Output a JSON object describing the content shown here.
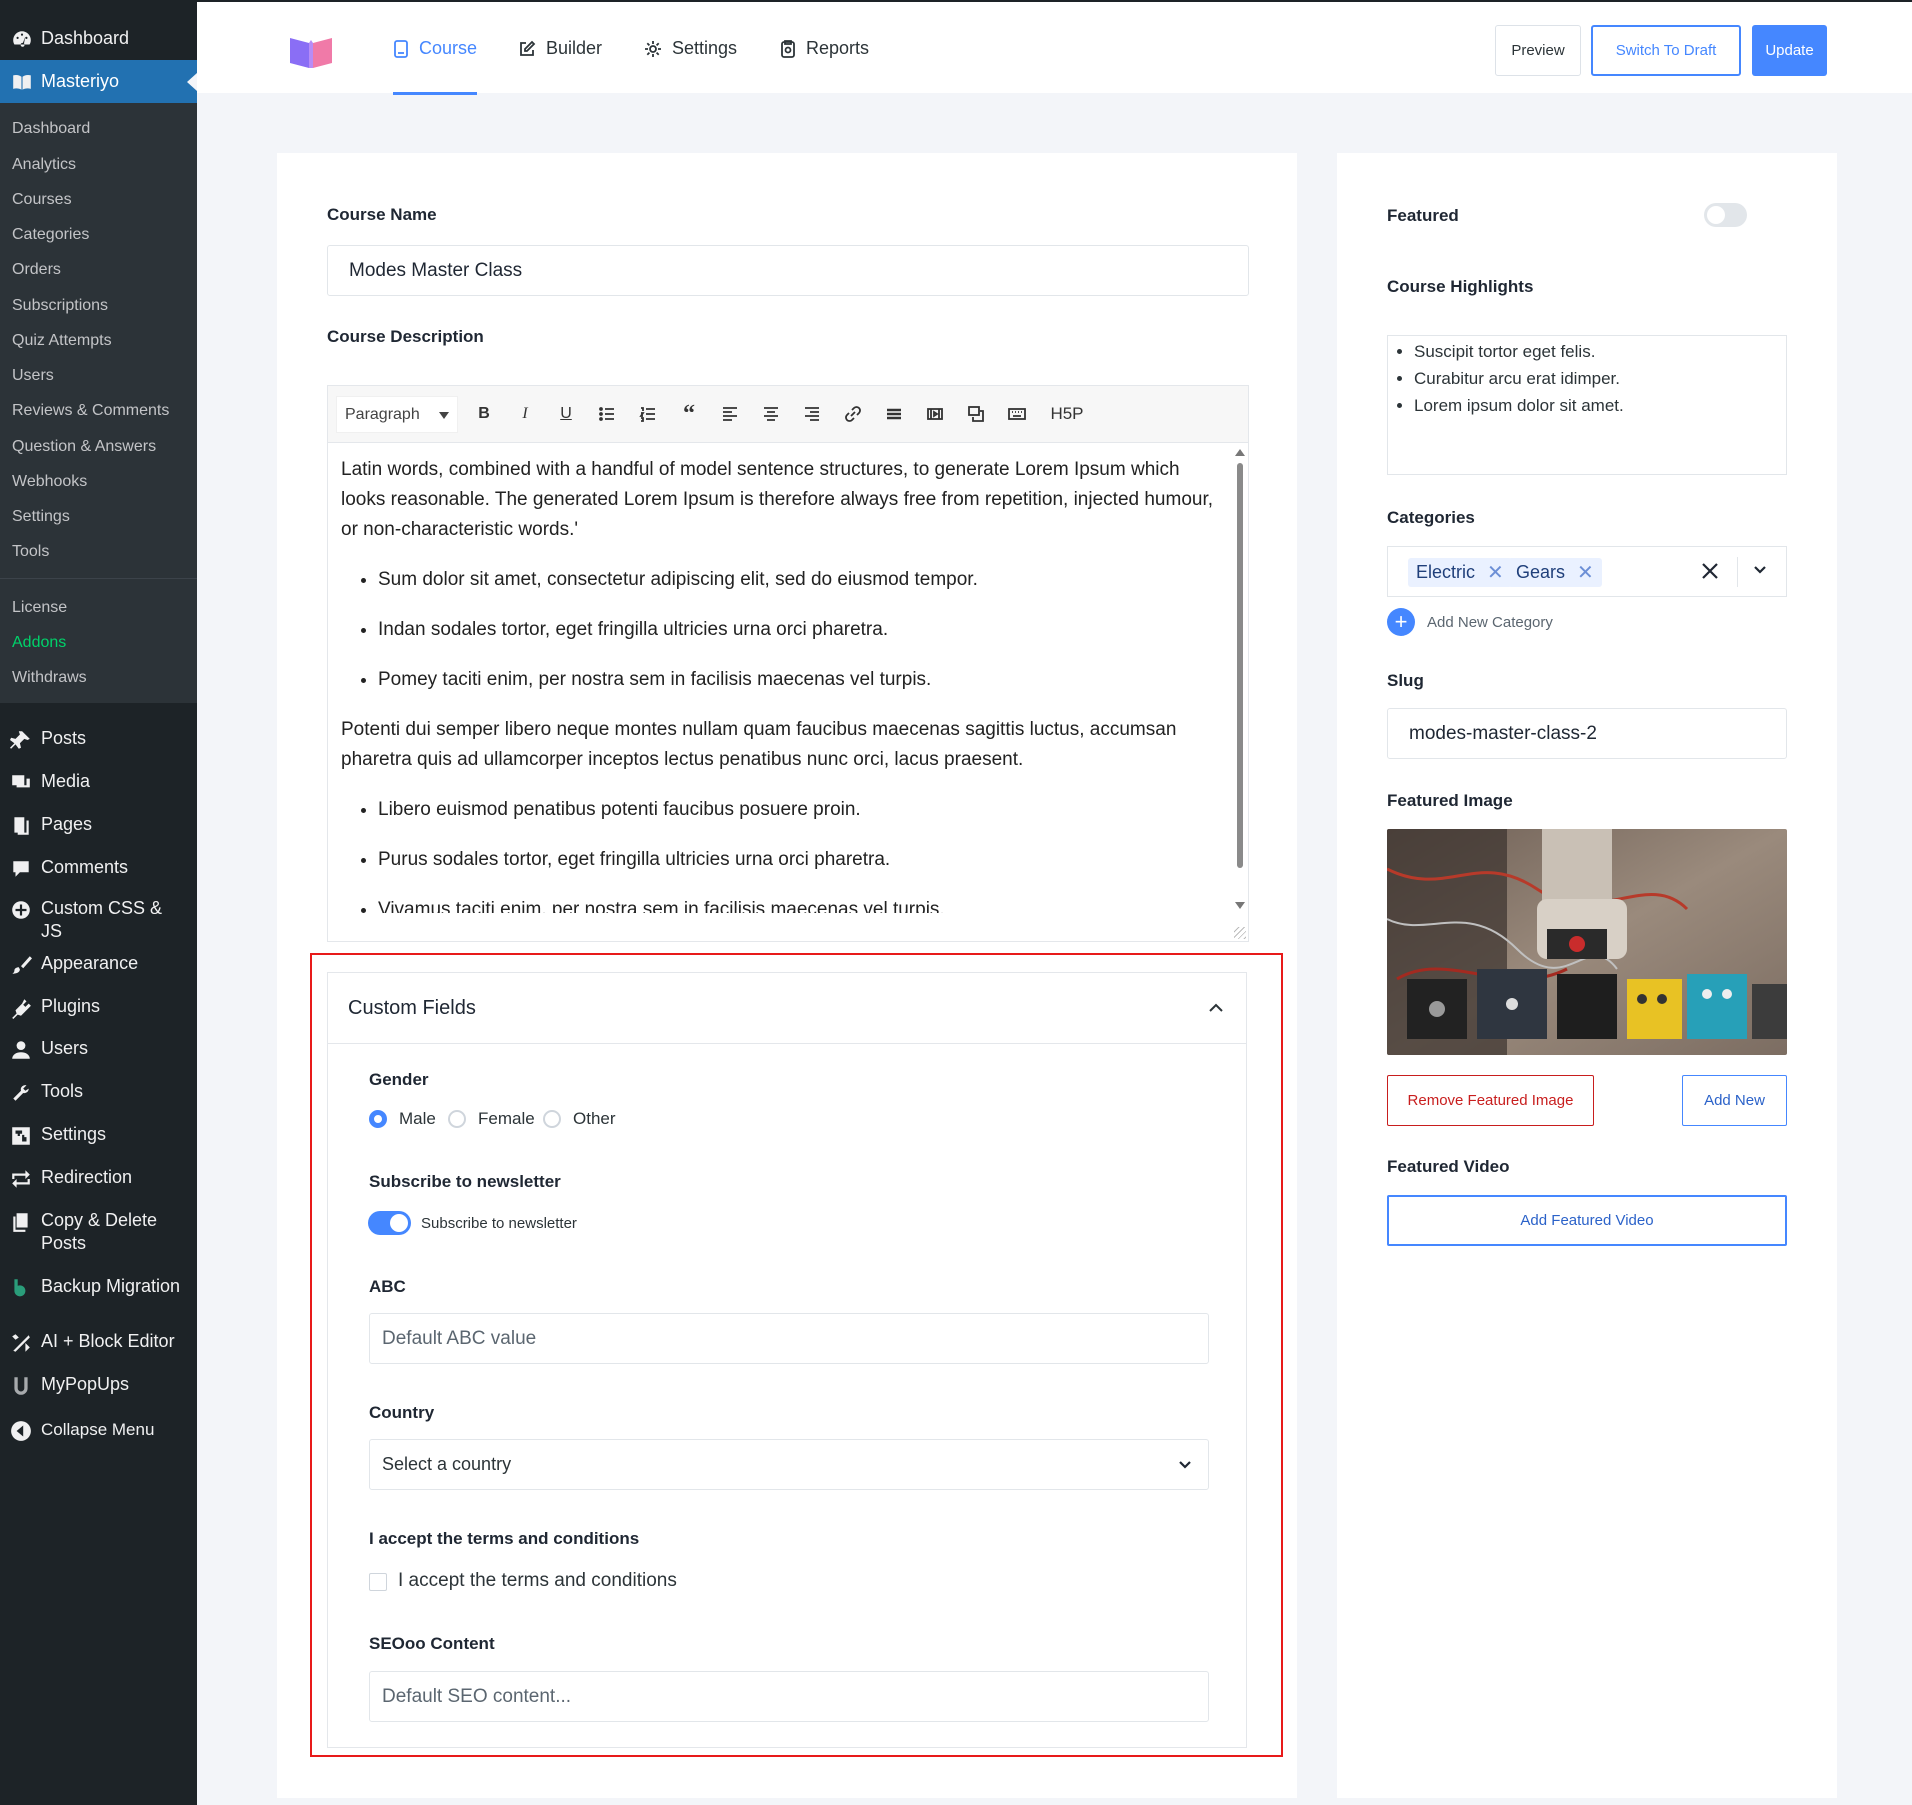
{
  "wp_menu": {
    "dashboard": "Dashboard",
    "masteriyo": "Masteriyo",
    "submenu": [
      "Dashboard",
      "Analytics",
      "Courses",
      "Categories",
      "Orders",
      "Subscriptions",
      "Quiz Attempts",
      "Users",
      "Reviews & Comments",
      "Question & Answers",
      "Webhooks",
      "Settings",
      "Tools"
    ],
    "submenu2": [
      "License",
      "Addons",
      "Withdraws"
    ],
    "items": [
      "Posts",
      "Media",
      "Pages",
      "Comments",
      "Custom CSS & JS",
      "Appearance",
      "Plugins",
      "Users",
      "Tools",
      "Settings",
      "Redirection",
      "Copy & Delete Posts",
      "Backup Migration",
      "AI + Block Editor",
      "MyPopUps",
      "Collapse Menu"
    ]
  },
  "header": {
    "tabs": [
      "Course",
      "Builder",
      "Settings",
      "Reports"
    ],
    "active_tab": "Course",
    "preview": "Preview",
    "switch_draft": "Switch To Draft",
    "update": "Update"
  },
  "course": {
    "name_label": "Course Name",
    "name_value": "Modes Master Class",
    "desc_label": "Course Description",
    "toolbar": {
      "format": "Paragraph",
      "h5p": "H5P"
    },
    "description": {
      "p1": "Latin words, combined with a handful of model sentence structures, to generate Lorem Ipsum which looks reasonable. The generated Lorem Ipsum is therefore always free from repetition, injected humour, or non-characteristic words.'",
      "list1": [
        "Sum dolor sit amet, consectetur adipiscing elit, sed do eiusmod tempor.",
        "Indan sodales tortor, eget fringilla ultricies urna orci pharetra.",
        "Pomey taciti enim, per nostra sem in facilisis maecenas vel turpis."
      ],
      "p2": "Potenti dui semper libero neque montes nullam quam faucibus maecenas sagittis luctus, accumsan pharetra quis ad ullamcorper inceptos lectus penatibus nunc orci, lacus praesent.",
      "list2": [
        "Libero euismod penatibus potenti faucibus posuere proin.",
        "Purus sodales tortor, eget fringilla ultricies urna orci pharetra.",
        "Vivamus taciti enim, per nostra sem in facilisis maecenas vel turpis."
      ]
    }
  },
  "custom_fields": {
    "title": "Custom Fields",
    "gender_label": "Gender",
    "gender_options": [
      "Male",
      "Female",
      "Other"
    ],
    "gender_selected": "Male",
    "newsletter_label": "Subscribe to newsletter",
    "newsletter_toggle_label": "Subscribe to newsletter",
    "newsletter_on": true,
    "abc_label": "ABC",
    "abc_placeholder": "Default ABC value",
    "country_label": "Country",
    "country_value": "Select a country",
    "terms_label": "I accept the terms and conditions",
    "terms_checkbox_label": "I accept the terms and conditions",
    "terms_checked": false,
    "seo_label": "SEOoo Content",
    "seo_placeholder": "Default SEO content..."
  },
  "side": {
    "featured_label": "Featured",
    "featured_on": false,
    "highlights_label": "Course Highlights",
    "highlights": [
      "Suscipit tortor eget felis.",
      "Curabitur arcu erat idimper.",
      "Lorem ipsum dolor sit amet."
    ],
    "categories_label": "Categories",
    "categories": [
      "Electric",
      "Gears"
    ],
    "add_category": "Add New Category",
    "slug_label": "Slug",
    "slug_value": "modes-master-class-2",
    "featured_image_label": "Featured Image",
    "remove_image": "Remove Featured Image",
    "add_new": "Add New",
    "featured_video_label": "Featured Video",
    "add_video": "Add Featured Video"
  },
  "colors": {
    "accent": "#4587ff",
    "highlight_border": "#e81a1a",
    "sidebar_bg": "#1d2327",
    "active_menu": "#2271b1",
    "danger": "#c81e1e"
  }
}
